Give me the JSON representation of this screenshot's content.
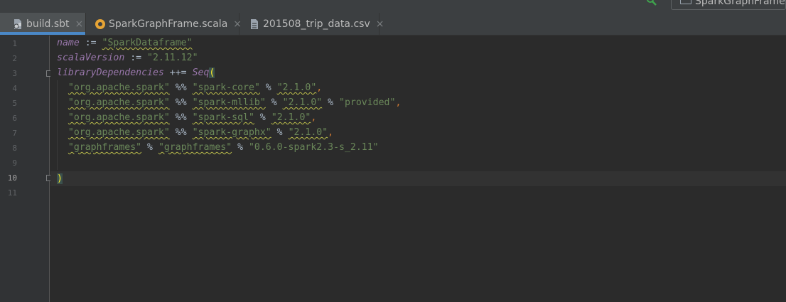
{
  "window": {
    "top_right_label": "SparkGraphFrame"
  },
  "tabs": [
    {
      "label": "build.sbt",
      "active": true
    },
    {
      "label": "SparkGraphFrame.scala",
      "active": false
    },
    {
      "label": "201508_trip_data.csv",
      "active": false
    }
  ],
  "tab_close_glyph": "×",
  "gutter": {
    "line_numbers": [
      "1",
      "2",
      "3",
      "4",
      "5",
      "6",
      "7",
      "8",
      "9",
      "10",
      "11"
    ],
    "current_line": "10"
  },
  "code": {
    "l1": {
      "key": "name",
      "op": " := ",
      "val": "\"SparkDataframe\""
    },
    "l2": {
      "key": "scalaVersion",
      "op": " := ",
      "val": "\"2.11.12\""
    },
    "l3": {
      "key": "libraryDependencies",
      "op": " ++= ",
      "fn": "Seq",
      "open": "("
    },
    "l4": {
      "g": "\"org.apache.spark\"",
      "o1": " %% ",
      "a": "\"spark-core\"",
      "o2": " % ",
      "v": "\"2.1.0\"",
      "end": ","
    },
    "l5": {
      "g": "\"org.apache.spark\"",
      "o1": " %% ",
      "a": "\"spark-mllib\"",
      "o2": " % ",
      "v": "\"2.1.0\"",
      "o3": " % ",
      "s": "\"provided\"",
      "end": ","
    },
    "l6": {
      "g": "\"org.apache.spark\"",
      "o1": " %% ",
      "a": "\"spark-sql\"",
      "o2": " % ",
      "v": "\"2.1.0\"",
      "end": ","
    },
    "l7": {
      "g": "\"org.apache.spark\"",
      "o1": " %% ",
      "a": "\"spark-graphx\"",
      "o2": " % ",
      "v": "\"2.1.0\"",
      "end": ","
    },
    "l8": {
      "g": "\"graphframes\"",
      "o1": " % ",
      "a": "\"graphframes\"",
      "o2": " % ",
      "v": "\"0.6.0-spark2.3-s_2.11\""
    },
    "l10": {
      "close": ")"
    }
  },
  "colors": {
    "background": "#2b2b2b",
    "keyword": "#9876aa",
    "string": "#6a8759",
    "operator": "#a9b7c6",
    "comma": "#cc7832",
    "active_tab_underline": "#4a88c7"
  },
  "icons": [
    "search-icon",
    "project-icon",
    "sbt-file-icon",
    "scala-file-icon",
    "csv-file-icon",
    "close-icon",
    "fold-icon"
  ]
}
